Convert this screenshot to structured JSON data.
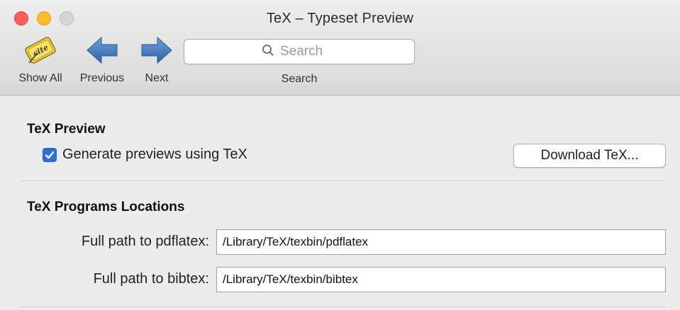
{
  "window": {
    "title": "TeX – Typeset Preview"
  },
  "toolbar": {
    "show_all_label": "Show All",
    "previous_label": "Previous",
    "next_label": "Next",
    "search_label": "Search",
    "search_placeholder": "Search",
    "search_value": ""
  },
  "preview_section": {
    "title": "TeX Preview",
    "checkbox_label": "Generate previews using TeX",
    "checkbox_checked": true,
    "download_button": "Download TeX..."
  },
  "programs_section": {
    "title": "TeX Programs Locations",
    "pdflatex_label": "Full path to pdflatex:",
    "pdflatex_value": "/Library/TeX/texbin/pdflatex",
    "bibtex_label": "Full path to bibtex:",
    "bibtex_value": "/Library/TeX/texbin/bibtex"
  },
  "icons": {
    "show_all": "cite-app-icon",
    "previous": "arrow-left-icon",
    "next": "arrow-right-icon",
    "search": "search-icon",
    "checkbox": "checkmark-icon"
  },
  "colors": {
    "accent": "#2d6fd8",
    "arrow_blue": "#3f7cc4",
    "close": "#fc5f57",
    "minimize": "#fdbc2e",
    "zoom": "#d6d6d6"
  }
}
